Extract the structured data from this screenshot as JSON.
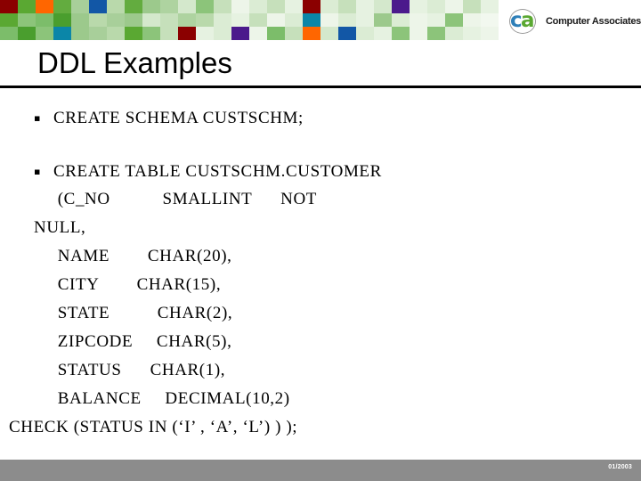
{
  "slide": {
    "title": "DDL Examples",
    "footer_note": "01/2003"
  },
  "brand": {
    "logo_c": "c",
    "logo_a": "a",
    "logo_name": "Computer Associates",
    "logo_tm": "™",
    "accent_blue": "#2e7fb8",
    "accent_green": "#5aa832",
    "footer_gray": "#8c8c8c"
  },
  "bullets": [
    {
      "marker": "▪",
      "text": "CREATE SCHEMA CUSTSCHM;"
    },
    {
      "marker": "▪",
      "text": "CREATE TABLE CUSTSCHM.CUSTOMER"
    }
  ],
  "code_lines": [
    "     (C_NO           SMALLINT      NOT",
    "NULL,",
    "     NAME        CHAR(20),",
    "     CITY        CHAR(15),",
    "     STATE          CHAR(2),",
    "     ZIPCODE     CHAR(5),",
    "     STATUS      CHAR(1),",
    "     BALANCE     DECIMAL(10,2)",
    "CHECK (STATUS IN (‘I’ , ‘A’, ‘L’) ) );"
  ],
  "mosaic": {
    "cols": 28,
    "rows": 3,
    "tiles": [
      "#8b0000",
      "#5aa832",
      "#ff6600",
      "#63ac3f",
      "#a8cf9a",
      "#1257a6",
      "#b9d9ab",
      "#63ac3f",
      "#9cc98c",
      "#aed3a0",
      "#d4e8cc",
      "#8cc47a",
      "#c6e0bb",
      "#edf5e9",
      "#dbecd4",
      "#c6e0bb",
      "#e6f2e1",
      "#8b0000",
      "#dbecd4",
      "#c6e0bb",
      "#e6f2e1",
      "#d4e8cc",
      "#4b1a8c",
      "#e6f2e1",
      "#dbecd4",
      "#edf5e9",
      "#c6e0bb",
      "#e6f2e1",
      "#5aa832",
      "#8cc47a",
      "#7cbd6a",
      "#4a9e2e",
      "#9cc98c",
      "#b9d9ab",
      "#a8cf9a",
      "#9cc98c",
      "#d4e8cc",
      "#c6e0bb",
      "#aed3a0",
      "#b9d9ab",
      "#dbecd4",
      "#e6f2e1",
      "#c6e0bb",
      "#edf5e9",
      "#dbecd4",
      "#0b86a8",
      "#edf5e9",
      "#dbecd4",
      "#e6f2e1",
      "#9cc98c",
      "#dbecd4",
      "#edf5e9",
      "#e6f2e1",
      "#8cc47a",
      "#edf5e9",
      "#f2f8ef",
      "#7cbd6a",
      "#4a9e2e",
      "#8cc47a",
      "#0b86a8",
      "#9cc98c",
      "#a8cf9a",
      "#b9d9ab",
      "#5aa832",
      "#8cc47a",
      "#c6e0bb",
      "#8b0000",
      "#e6f2e1",
      "#dbecd4",
      "#4b1a8c",
      "#edf5e9",
      "#7cbd6a",
      "#c6e0bb",
      "#ff6600",
      "#d4e8cc",
      "#1257a6",
      "#dbecd4",
      "#e6f2e1",
      "#8cc47a",
      "#edf5e9",
      "#8cc47a",
      "#dbecd4",
      "#e6f2e1",
      "#edf5e9"
    ]
  }
}
